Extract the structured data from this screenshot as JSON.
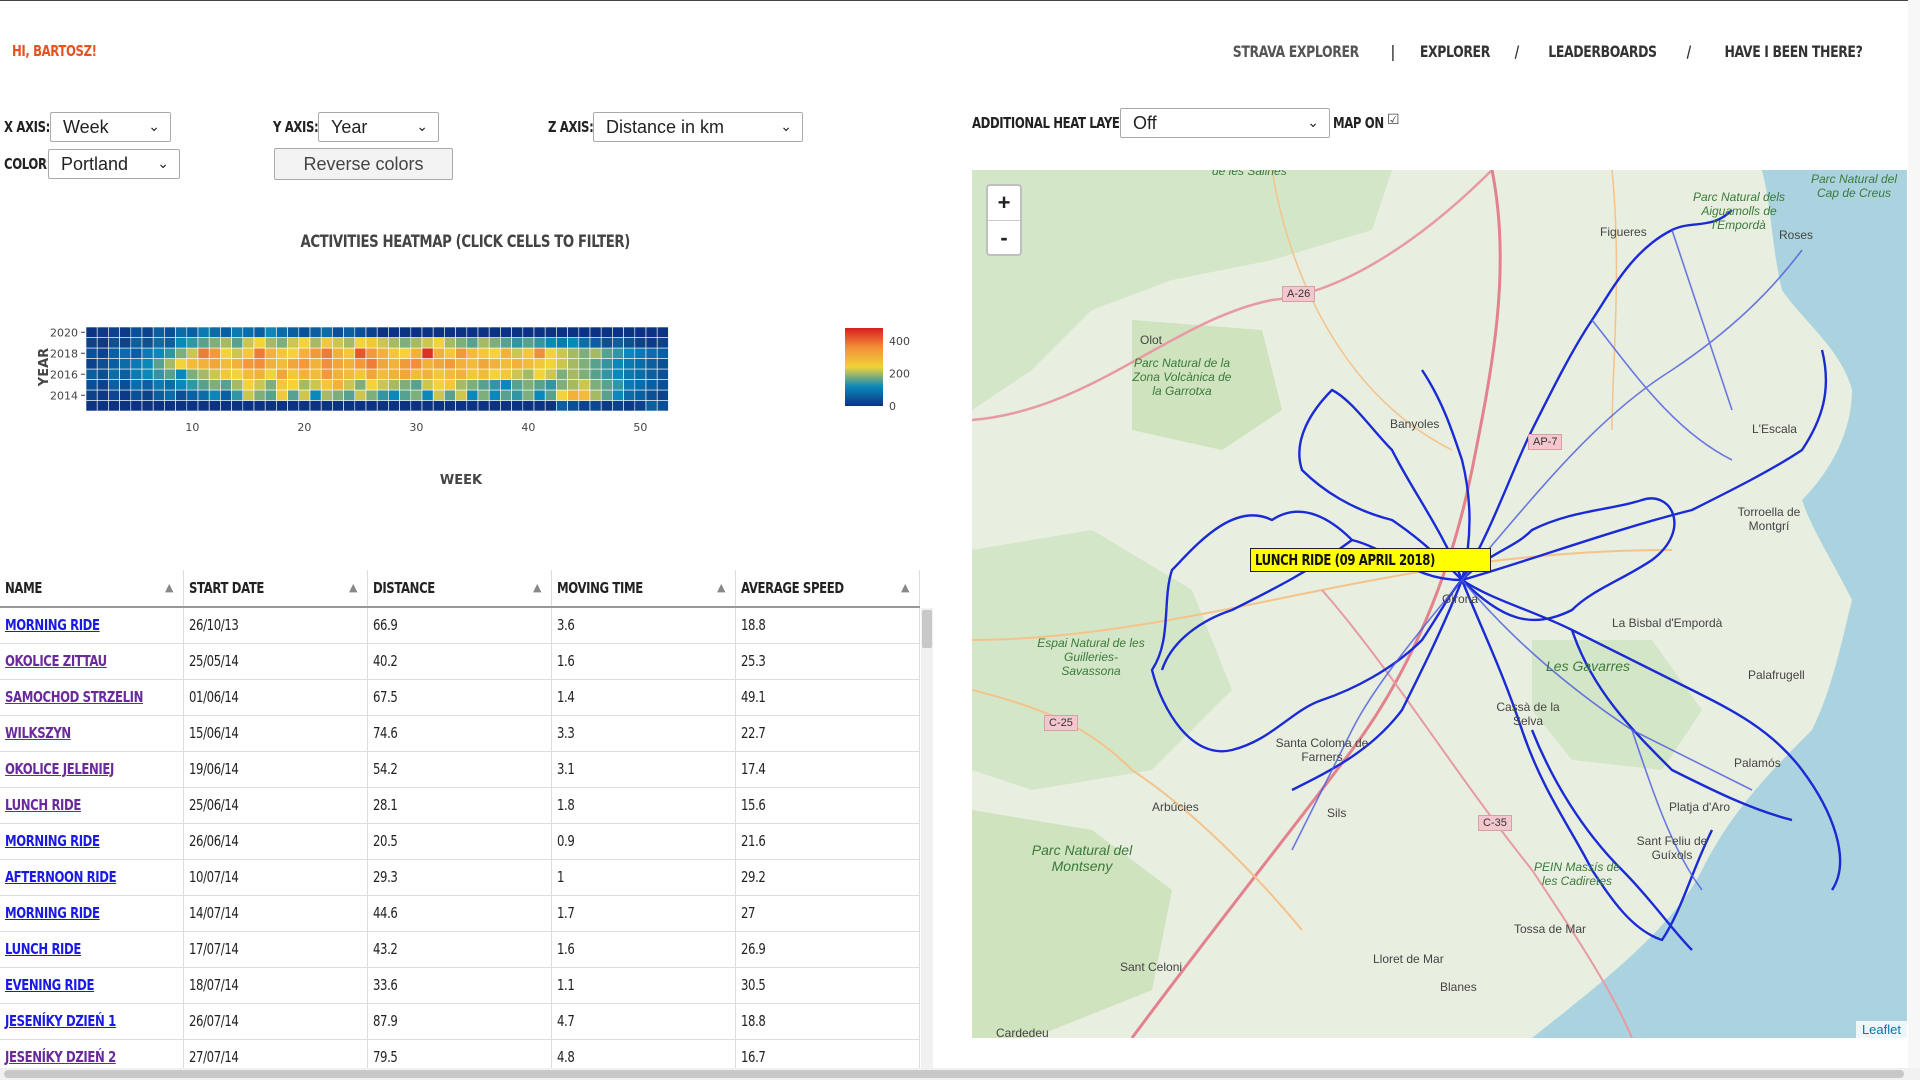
{
  "header": {
    "greeting": "HI, BARTOSZ!",
    "nav": [
      {
        "label": "STRAVA EXPLORER",
        "name": "nav-strava-explorer"
      },
      {
        "label": "|",
        "name": "nav-sep"
      },
      {
        "label": "EXPLORER",
        "name": "nav-explorer"
      },
      {
        "label": "/",
        "name": "nav-sep"
      },
      {
        "label": "LEADERBOARDS",
        "name": "nav-leaderboards"
      },
      {
        "label": "/",
        "name": "nav-sep"
      },
      {
        "label": "HAVE I BEEN THERE?",
        "name": "nav-have-i-been-there"
      }
    ]
  },
  "controls": {
    "x_axis_label": "X AXIS:",
    "x_axis_value": "Week",
    "y_axis_label": "Y AXIS:",
    "y_axis_value": "Year",
    "z_axis_label": "Z AXIS:",
    "z_axis_value": "Distance in km",
    "color_label": "COLOR:",
    "color_value": "Portland",
    "reverse_colors": "Reverse colors",
    "heat_layer_label": "ADDITIONAL HEAT LAYER:",
    "heat_layer_value": "Off",
    "map_on_label": "MAP ON",
    "map_on_checked": true
  },
  "heatmap": {
    "title": "ACTIVITIES HEATMAP (CLICK CELLS TO FILTER)",
    "xlabel": "WEEK",
    "ylabel": "YEAR",
    "x_ticks": [
      "10",
      "20",
      "30",
      "40",
      "50"
    ],
    "y_ticks": [
      "2020",
      "2018",
      "2016",
      "2014"
    ],
    "colorbar_ticks": [
      "400",
      "200",
      "0"
    ]
  },
  "chart_data": {
    "type": "heatmap",
    "title": "ACTIVITIES HEATMAP (CLICK CELLS TO FILTER)",
    "xlabel": "WEEK",
    "ylabel": "YEAR",
    "x": [
      1,
      2,
      3,
      4,
      5,
      6,
      7,
      8,
      9,
      10,
      11,
      12,
      13,
      14,
      15,
      16,
      17,
      18,
      19,
      20,
      21,
      22,
      23,
      24,
      25,
      26,
      27,
      28,
      29,
      30,
      31,
      32,
      33,
      34,
      35,
      36,
      37,
      38,
      39,
      40,
      41,
      42,
      43,
      44,
      45,
      46,
      47,
      48,
      49,
      50,
      51,
      52
    ],
    "y": [
      2013,
      2014,
      2015,
      2016,
      2017,
      2018,
      2019,
      2020
    ],
    "zlim": [
      0,
      480
    ],
    "colorscale": "Portland",
    "values": [
      [
        0,
        0,
        0,
        0,
        0,
        0,
        0,
        0,
        0,
        0,
        0,
        0,
        0,
        0,
        0,
        0,
        0,
        0,
        0,
        0,
        0,
        0,
        0,
        0,
        0,
        0,
        0,
        0,
        0,
        0,
        0,
        0,
        0,
        0,
        0,
        0,
        0,
        0,
        0,
        0,
        0,
        0,
        60,
        40,
        20,
        30,
        10,
        20,
        10,
        20,
        60,
        40
      ],
      [
        20,
        10,
        30,
        10,
        40,
        20,
        60,
        80,
        40,
        60,
        80,
        120,
        60,
        140,
        220,
        180,
        160,
        260,
        160,
        220,
        120,
        200,
        180,
        160,
        220,
        180,
        140,
        120,
        160,
        180,
        120,
        220,
        160,
        220,
        120,
        180,
        120,
        160,
        140,
        180,
        120,
        160,
        240,
        300,
        280,
        200,
        160,
        120,
        80,
        60,
        40,
        20
      ],
      [
        40,
        20,
        60,
        40,
        80,
        60,
        100,
        80,
        120,
        140,
        160,
        180,
        160,
        200,
        240,
        220,
        180,
        260,
        240,
        200,
        220,
        260,
        300,
        220,
        180,
        240,
        220,
        200,
        180,
        160,
        220,
        240,
        260,
        200,
        180,
        160,
        140,
        120,
        160,
        180,
        160,
        140,
        180,
        200,
        220,
        180,
        160,
        140,
        100,
        80,
        60,
        40
      ],
      [
        60,
        40,
        80,
        60,
        100,
        120,
        140,
        160,
        120,
        180,
        200,
        220,
        260,
        240,
        280,
        300,
        240,
        320,
        260,
        300,
        280,
        340,
        300,
        280,
        260,
        320,
        280,
        300,
        320,
        280,
        300,
        260,
        280,
        300,
        260,
        280,
        240,
        260,
        220,
        200,
        240,
        220,
        180,
        200,
        180,
        160,
        140,
        120,
        100,
        80,
        60,
        40
      ],
      [
        20,
        40,
        60,
        80,
        100,
        120,
        160,
        200,
        240,
        280,
        300,
        320,
        280,
        300,
        340,
        360,
        300,
        280,
        320,
        340,
        300,
        360,
        320,
        300,
        340,
        380,
        320,
        300,
        340,
        360,
        300,
        320,
        340,
        300,
        280,
        320,
        300,
        280,
        300,
        280,
        260,
        240,
        220,
        200,
        180,
        160,
        140,
        120,
        100,
        80,
        60,
        40
      ],
      [
        40,
        20,
        60,
        80,
        60,
        100,
        120,
        140,
        180,
        220,
        380,
        340,
        240,
        220,
        260,
        380,
        300,
        260,
        240,
        300,
        340,
        380,
        300,
        260,
        420,
        340,
        300,
        260,
        240,
        300,
        460,
        300,
        260,
        340,
        280,
        260,
        240,
        300,
        220,
        260,
        360,
        240,
        220,
        200,
        180,
        200,
        160,
        140,
        120,
        100,
        80,
        60
      ],
      [
        20,
        10,
        40,
        20,
        60,
        40,
        80,
        60,
        120,
        140,
        160,
        180,
        200,
        160,
        220,
        240,
        200,
        180,
        220,
        240,
        200,
        260,
        220,
        200,
        240,
        260,
        220,
        200,
        180,
        200,
        220,
        240,
        200,
        180,
        160,
        200,
        180,
        160,
        140,
        160,
        140,
        120,
        100,
        120,
        80,
        60,
        40,
        60,
        40,
        20,
        10,
        20
      ],
      [
        0,
        10,
        20,
        10,
        40,
        20,
        60,
        40,
        80,
        60,
        100,
        80,
        60,
        100,
        80,
        60,
        120,
        80,
        60,
        40,
        60,
        80,
        40,
        60,
        40,
        20,
        0,
        0,
        0,
        0,
        0,
        0,
        0,
        0,
        0,
        0,
        0,
        0,
        0,
        0,
        0,
        0,
        0,
        0,
        0,
        0,
        0,
        0,
        0,
        0,
        0,
        0
      ]
    ]
  },
  "table": {
    "columns": [
      "NAME",
      "START DATE",
      "DISTANCE",
      "MOVING TIME",
      "AVERAGE SPEED"
    ],
    "rows": [
      {
        "name": "MORNING RIDE",
        "date": "26/10/13",
        "distance": "66.9",
        "time": "3.6",
        "speed": "18.8",
        "visited": false
      },
      {
        "name": "OKOLICE ZITTAU",
        "date": "25/05/14",
        "distance": "40.2",
        "time": "1.6",
        "speed": "25.3",
        "visited": true
      },
      {
        "name": "SAMOCHOD STRZELIN",
        "date": "01/06/14",
        "distance": "67.5",
        "time": "1.4",
        "speed": "49.1",
        "visited": true
      },
      {
        "name": "WILKSZYN",
        "date": "15/06/14",
        "distance": "74.6",
        "time": "3.3",
        "speed": "22.7",
        "visited": true
      },
      {
        "name": "OKOLICE JELENIEJ",
        "date": "19/06/14",
        "distance": "54.2",
        "time": "3.1",
        "speed": "17.4",
        "visited": true
      },
      {
        "name": "LUNCH RIDE",
        "date": "25/06/14",
        "distance": "28.1",
        "time": "1.8",
        "speed": "15.6",
        "visited": true
      },
      {
        "name": "MORNING RIDE",
        "date": "26/06/14",
        "distance": "20.5",
        "time": "0.9",
        "speed": "21.6",
        "visited": false
      },
      {
        "name": "AFTERNOON RIDE",
        "date": "10/07/14",
        "distance": "29.3",
        "time": "1",
        "speed": "29.2",
        "visited": false
      },
      {
        "name": "MORNING RIDE",
        "date": "14/07/14",
        "distance": "44.6",
        "time": "1.7",
        "speed": "27",
        "visited": false
      },
      {
        "name": "LUNCH RIDE",
        "date": "17/07/14",
        "distance": "43.2",
        "time": "1.6",
        "speed": "26.9",
        "visited": false
      },
      {
        "name": "EVENING RIDE",
        "date": "18/07/14",
        "distance": "33.6",
        "time": "1.1",
        "speed": "30.5",
        "visited": false
      },
      {
        "name": "JESENÍKY DZIEŃ 1",
        "date": "26/07/14",
        "distance": "87.9",
        "time": "4.7",
        "speed": "18.8",
        "visited": false
      },
      {
        "name": "JESENÍKY DZIEŃ 2",
        "date": "27/07/14",
        "distance": "79.5",
        "time": "4.8",
        "speed": "16.7",
        "visited": true
      }
    ]
  },
  "map": {
    "zoom_in": "+",
    "zoom_out": "-",
    "tooltip": "LUNCH RIDE (09 APRIL 2018)",
    "attribution": "Leaflet",
    "labels": [
      {
        "text": "Figueres",
        "kind": "town"
      },
      {
        "text": "Roses",
        "kind": "town"
      },
      {
        "text": "Olot",
        "kind": "town"
      },
      {
        "text": "Banyoles",
        "kind": "town"
      },
      {
        "text": "L'Escala",
        "kind": "town"
      },
      {
        "text": "Torroella de Montgrí",
        "kind": "town"
      },
      {
        "text": "Girona",
        "kind": "town"
      },
      {
        "text": "La Bisbal d'Empordà",
        "kind": "town"
      },
      {
        "text": "Les Gavarres",
        "kind": "park"
      },
      {
        "text": "Palafrugell",
        "kind": "town"
      },
      {
        "text": "Cassà de la Selva",
        "kind": "town"
      },
      {
        "text": "Santa Coloma de Farners",
        "kind": "town"
      },
      {
        "text": "Palamós",
        "kind": "town"
      },
      {
        "text": "Arbúcies",
        "kind": "town"
      },
      {
        "text": "Sils",
        "kind": "town"
      },
      {
        "text": "Platja d'Aro",
        "kind": "town"
      },
      {
        "text": "Sant Feliu de Guíxols",
        "kind": "town"
      },
      {
        "text": "Tossa de Mar",
        "kind": "town"
      },
      {
        "text": "Lloret de Mar",
        "kind": "town"
      },
      {
        "text": "Blanes",
        "kind": "town"
      },
      {
        "text": "Sant Celoni",
        "kind": "town"
      },
      {
        "text": "Cardedeu",
        "kind": "town"
      },
      {
        "text": "Parc Natural del Montseny",
        "kind": "park"
      },
      {
        "text": "Parc Natural de la Zona Volcànica de la Garrotxa",
        "kind": "park"
      },
      {
        "text": "Espai Natural de les Guilleries-Savassona",
        "kind": "park"
      },
      {
        "text": "Parc Natural dels Aiguamolls de l'Empordà",
        "kind": "park"
      },
      {
        "text": "Parc Natural del Cap de Creus",
        "kind": "park"
      },
      {
        "text": "PEIN Massís de les Cadiretes",
        "kind": "park"
      },
      {
        "text": "A-26",
        "kind": "road"
      },
      {
        "text": "AP-7",
        "kind": "road"
      },
      {
        "text": "C-25",
        "kind": "road"
      },
      {
        "text": "C-35",
        "kind": "road"
      },
      {
        "text": "de les Salines",
        "kind": "park"
      }
    ]
  }
}
